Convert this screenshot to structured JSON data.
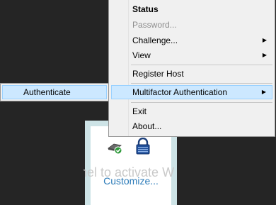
{
  "context_menu": {
    "items": [
      {
        "label": "Status",
        "bold": true
      },
      {
        "label": "Password...",
        "disabled": true
      },
      {
        "label": "Challenge...",
        "has_submenu": true
      },
      {
        "label": "View",
        "has_submenu": true
      },
      {
        "label": "Register Host"
      },
      {
        "label": "Multifactor Authentication",
        "has_submenu": true,
        "highlighted": true
      },
      {
        "label": "Exit"
      },
      {
        "label": "About..."
      }
    ],
    "arrow_glyph": "▶"
  },
  "submenu": {
    "items": [
      {
        "label": "Authenticate",
        "highlighted": true
      }
    ]
  },
  "tray_panel": {
    "watermark_text": "nel to activate W",
    "customize_label": "Customize...",
    "icons": [
      "network-key-icon",
      "lock-icon"
    ]
  },
  "colors": {
    "desktop_bg": "#252525",
    "menu_bg": "#f0f0f0",
    "highlight_bg": "#cce8ff",
    "highlight_border": "#99d1ff",
    "link_blue": "#2a7ab8",
    "tray_panel_bg": "#cde3e6"
  }
}
